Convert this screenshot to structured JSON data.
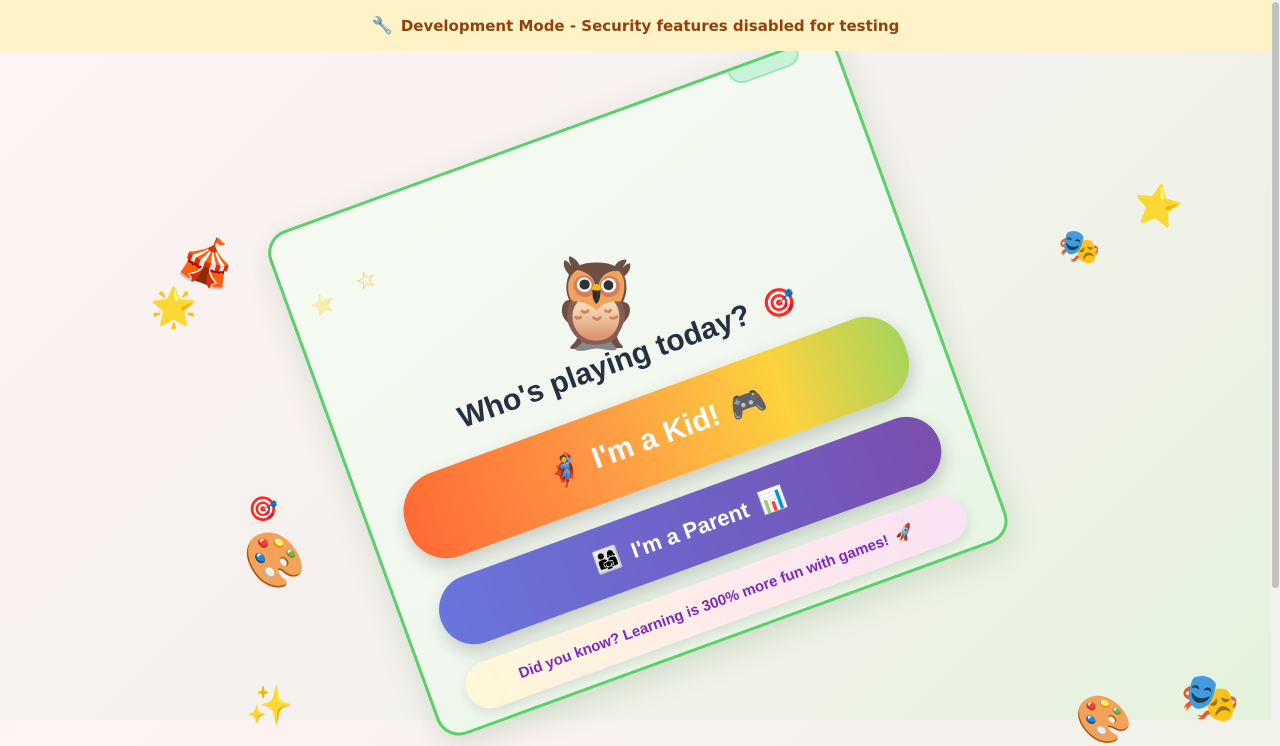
{
  "banner": {
    "icon": "wrench-icon",
    "icon_glyph": "🔧",
    "text": "Development Mode - Security features disabled for testing"
  },
  "card": {
    "mascot_icon": "owl-icon",
    "mascot_glyph": "🦉",
    "title": "Who's playing today?",
    "title_icon": "🎯",
    "kid_button": {
      "icon_left": "🦸",
      "label": "I'm a Kid!",
      "icon_right": "🎮"
    },
    "parent_button": {
      "icon_left": "👨‍👩‍👧",
      "label": "I'm a Parent",
      "icon_right": "📊"
    },
    "tip": {
      "text": "Did you know? Learning is 300% more fun with games!",
      "icon": "🚀"
    }
  },
  "decorations": {
    "circus_tent": "🎪",
    "glowing_star": "🌟",
    "star": "⭐",
    "masks": "🎭",
    "target": "🎯",
    "palette": "🎨",
    "sparkles": "✨",
    "outline_star": "☆"
  },
  "colors": {
    "banner_bg": "#fef3c6",
    "banner_text": "#92400e",
    "card_border": "#5bd06a",
    "parent_button": "#6f62c7",
    "tip_text": "#7b2ac0"
  }
}
